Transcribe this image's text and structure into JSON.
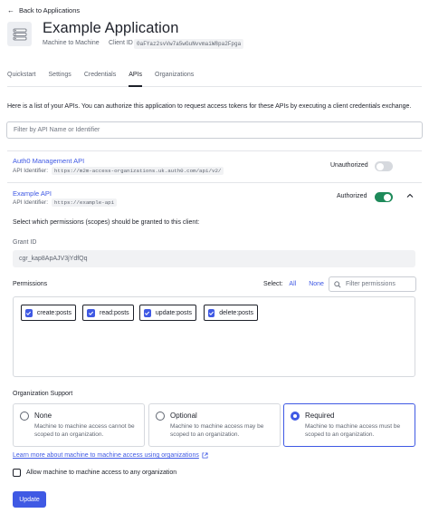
{
  "nav": {
    "back_label": "Back to Applications"
  },
  "header": {
    "title": "Example Application",
    "app_type": "Machine to Machine",
    "client_id_label": "Client ID",
    "client_id_value": "0aFYaz2svVw7a5wGuNvvmaiW8pa2Fpga"
  },
  "tabs": [
    {
      "label": "Quickstart",
      "active": false
    },
    {
      "label": "Settings",
      "active": false
    },
    {
      "label": "Credentials",
      "active": false
    },
    {
      "label": "APIs",
      "active": true
    },
    {
      "label": "Organizations",
      "active": false
    }
  ],
  "description": "Here is a list of your APIs. You can authorize this application to request access tokens for these APIs by executing a client credentials exchange.",
  "filter": {
    "placeholder": "Filter by API Name or Identifier"
  },
  "apis": [
    {
      "name": "Auth0 Management API",
      "identifier_label": "API Identifier:",
      "identifier": "https://m2m-access-organizations.uk.auth0.com/api/v2/",
      "status": "Unauthorized",
      "authorized": false
    },
    {
      "name": "Example API",
      "identifier_label": "API Identifier:",
      "identifier": "https://example-api",
      "status": "Authorized",
      "authorized": true
    }
  ],
  "expanded": {
    "scopes_prompt": "Select which permissions (scopes) should be granted to this client:",
    "grant_label": "Grant ID",
    "grant_value": "cgr_kap8ApAJV3jYdfQq",
    "permissions_label": "Permissions",
    "select_label": "Select:",
    "select_all": "All",
    "select_none": "None",
    "permissions_filter_placeholder": "Filter permissions",
    "permissions": [
      "create:posts",
      "read:posts",
      "update:posts",
      "delete:posts"
    ]
  },
  "org_support": {
    "label": "Organization Support",
    "options": [
      {
        "title": "None",
        "desc": "Machine to machine access cannot be scoped to an organization.",
        "selected": false
      },
      {
        "title": "Optional",
        "desc": "Machine to machine access may be scoped to an organization.",
        "selected": false
      },
      {
        "title": "Required",
        "desc": "Machine to machine access must be scoped to an organization.",
        "selected": true
      }
    ],
    "learn_more": "Learn more about machine to machine access using organizations",
    "allow_any": "Allow machine to machine access to any organization"
  },
  "actions": {
    "update_label": "Update"
  },
  "colors": {
    "accent": "#3f59e4",
    "toggle_on": "#1e8a5a",
    "toggle_off": "#d6d9de"
  },
  "icons": [
    "arrow-left-icon",
    "application-icon",
    "search-icon",
    "chevron-up-icon",
    "external-link-icon",
    "checkmark-icon"
  ]
}
